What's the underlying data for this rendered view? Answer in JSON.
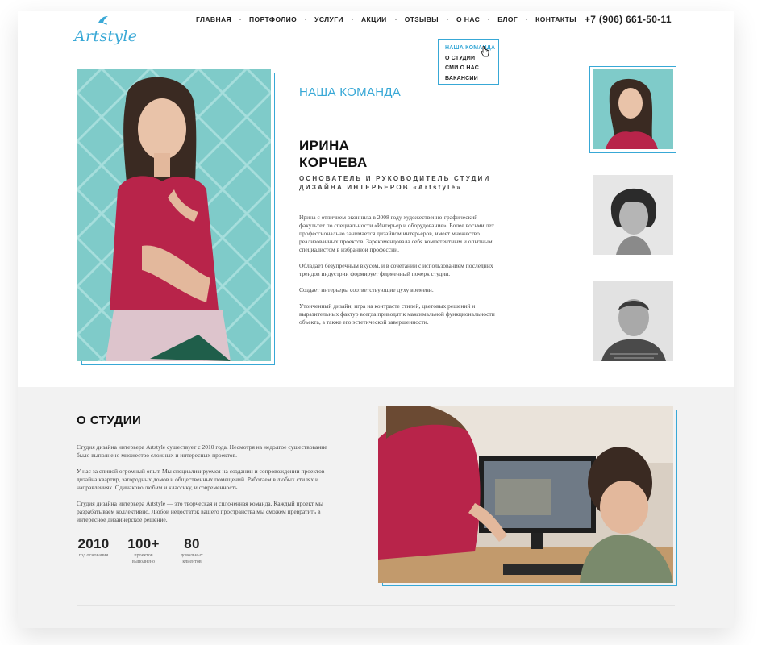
{
  "brand": {
    "logo_text": "Artstyle",
    "accent_color": "#38a8d6"
  },
  "nav": {
    "items": [
      {
        "label": "ГЛАВНАЯ"
      },
      {
        "label": "ПОРТФОЛИО"
      },
      {
        "label": "УСЛУГИ"
      },
      {
        "label": "АКЦИИ"
      },
      {
        "label": "ОТЗЫВЫ"
      },
      {
        "label": "О НАС"
      },
      {
        "label": "БЛОГ"
      },
      {
        "label": "КОНТАКТЫ"
      }
    ],
    "phone": "+7 (906) 661-50-11"
  },
  "dropdown": {
    "items": [
      {
        "label": "НАША КОМАНДА"
      },
      {
        "label": "О СТУДИИ"
      },
      {
        "label": "СМИ О НАС"
      },
      {
        "label": "ВАКАНСИИ"
      }
    ]
  },
  "team": {
    "section_title": "НАША КОМАНДА",
    "name_line1": "ИРИНА",
    "name_line2": "КОРЧЕВА",
    "role_line1": "ОСНОВАТЕЛЬ И РУКОВОДИТЕЛЬ СТУДИИ",
    "role_line2": "ДИЗАЙНА ИНТЕРЬЕРОВ «Artstyle»",
    "bio": [
      "Ирина с отличием окончила в 2008 году художественно-графический факультет по специальности «Интерьер и оборудование». Более восьми лет профессионально занимается дизайном интерьеров, имеет множество реализованных проектов. Зарекомендовала себя компетентным и опытным специалистом в избранной профессии.",
      "Обладает безупречным вкусом, и в сочетании с использованием последних трендов индустрии формирует фирменный почерк студии.",
      "Создает интерьеры соответствующие духу времени.",
      "Утонченный дизайн, игра на контрасте стилей, цветовых решений и выразительных фактур всегда приводят к максимальной функциональности объекта, а также его эстетической завершенности."
    ]
  },
  "studio": {
    "title": "О СТУДИИ",
    "paragraphs": [
      "Студия дизайна интерьера Artstyle существует с 2010 года. Несмотря на недолгое существование было выполнено множество сложных и интересных проектов.",
      "У нас за спиной огромный опыт. Мы специализируемся на создании и сопровождении проектов дизайна квартир, загородных домов и общественных помещений. Работаем в любых стилях и направлениях. Одинаково любим и классику, и современность.",
      "Студия дизайна интерьера Artstyle — это творческая и сплоченная команда. Каждый проект мы разрабатываем коллективно. Любой недостаток вашего пространства мы сможем превратить в интересное дизайнерское решение."
    ],
    "stats": [
      {
        "value": "2010",
        "label1": "год основания",
        "label2": ""
      },
      {
        "value": "100+",
        "label1": "проектов",
        "label2": "выполнено"
      },
      {
        "value": "80",
        "label1": "довольных",
        "label2": "клиентов"
      }
    ]
  }
}
